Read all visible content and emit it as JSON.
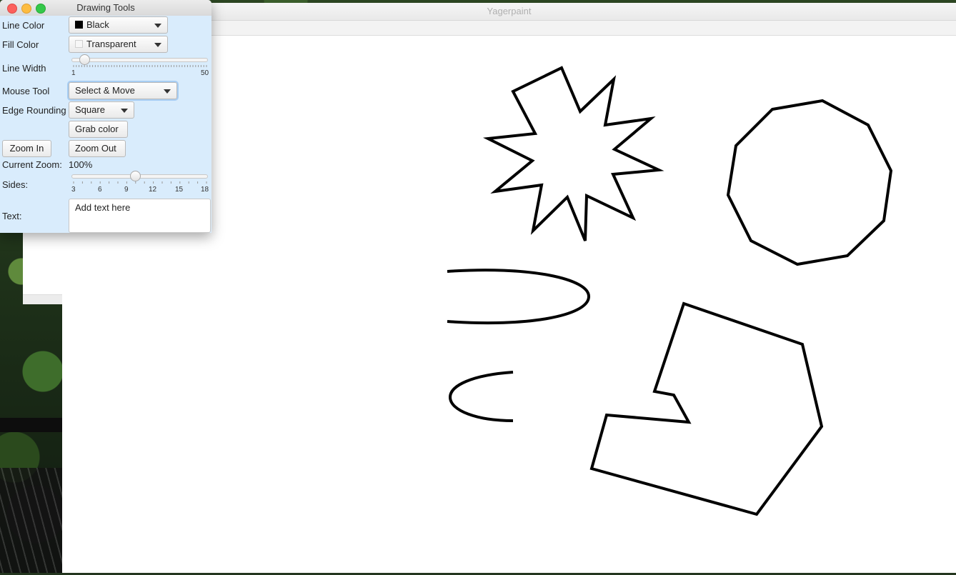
{
  "main_window": {
    "title": "Yagerpaint"
  },
  "tools_window": {
    "title": "Drawing Tools",
    "line_color": {
      "label": "Line Color",
      "value": "Black",
      "swatch": "#000000"
    },
    "fill_color": {
      "label": "Fill Color",
      "value": "Transparent"
    },
    "line_width": {
      "label": "Line Width",
      "min_label": "1",
      "max_label": "50",
      "value": 3
    },
    "mouse_tool": {
      "label": "Mouse Tool",
      "value": "Select & Move"
    },
    "edge_rounding": {
      "label": "Edge Rounding",
      "value": "Square"
    },
    "grab_color": {
      "label": "Grab color"
    },
    "zoom_in": {
      "label": "Zoom In"
    },
    "zoom_out": {
      "label": "Zoom Out"
    },
    "current_zoom": {
      "label": "Current Zoom:",
      "value": "100%"
    },
    "sides": {
      "label": "Sides:",
      "tick_labels": [
        "3",
        "6",
        "9",
        "12",
        "15",
        "18"
      ],
      "value": 10
    },
    "text": {
      "label": "Text:",
      "placeholder": "Add text here"
    }
  },
  "colors": {
    "panel_bg": "#d9ecfc",
    "stroke": "#000000"
  },
  "canvas_shapes": [
    "star",
    "decagon",
    "half-ellipse",
    "half-ellipse",
    "polygon"
  ]
}
